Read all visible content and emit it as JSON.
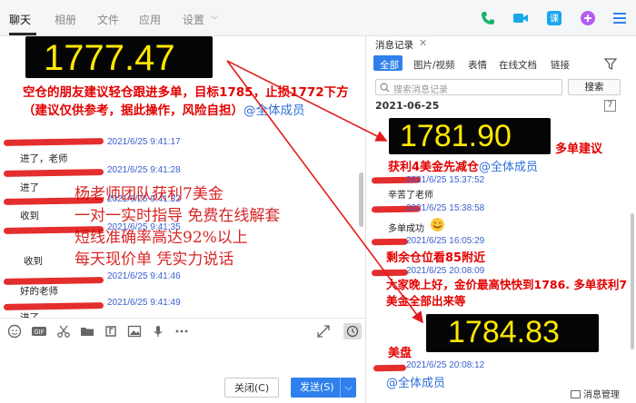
{
  "nav": {
    "tabs": [
      "聊天",
      "相册",
      "文件",
      "应用",
      "设置"
    ],
    "active_tab": "聊天"
  },
  "left": {
    "price": "1777.47",
    "note": "空仓的朋友建议轻仓跟进多单，目标1785，止损1772下方（建议仅供参考，据此操作，风险自担）",
    "mention": "@全体成员",
    "messages": [
      {
        "time": "2021/6/25 9:41:17",
        "text": "进了，老师"
      },
      {
        "time": "2021/6/25 9:41:28",
        "text": "进了"
      },
      {
        "time": "2021/6/25 9:41:32",
        "text": "收到"
      },
      {
        "time": "2021/6/25 9:41:35",
        "text": "收到"
      },
      {
        "time": "2021/6/25 9:41:46",
        "text": "好的老师"
      },
      {
        "time": "2021/6/25 9:41:49",
        "text": "进了"
      }
    ],
    "overlay": [
      "杨老师团队获利7美金",
      "一对一实时指导   免费在线解套",
      "短线准确率高达92%以上",
      "每天现价单      凭实力说话"
    ]
  },
  "toolbar": {
    "close_label": "关闭(C)",
    "send_label": "发送(S)"
  },
  "right": {
    "title": "消息记录",
    "tabs": [
      "全部",
      "图片/视频",
      "表情",
      "在线文档",
      "链接"
    ],
    "search_placeholder": "搜索消息记录",
    "search_button": "搜索",
    "date": "2021-06-25",
    "price1": "1781.90",
    "label1": "多单建议",
    "profit": "获利4美金先减仓",
    "mention": "@全体成员",
    "msgs": [
      {
        "time": "2021/6/25 15:37:52",
        "text": "辛苦了老师"
      },
      {
        "time": "2021/6/25 15:38:58",
        "text": "多单成功"
      },
      {
        "time": "2021/6/25 16:05:29",
        "text": "剩余仓位看85附近"
      },
      {
        "time": "2021/6/25 20:08:09",
        "text": "大家晚上好，金价最高快快到1786. 多单获利7美金全部出来等"
      }
    ],
    "price2": "1784.83",
    "label2": "美盘",
    "last_time": "2021/6/25 20:08:12",
    "manage": "消息管理"
  },
  "colors": {
    "accent": "#2f80ed",
    "red": "#e30000",
    "yellow": "#fde800"
  }
}
